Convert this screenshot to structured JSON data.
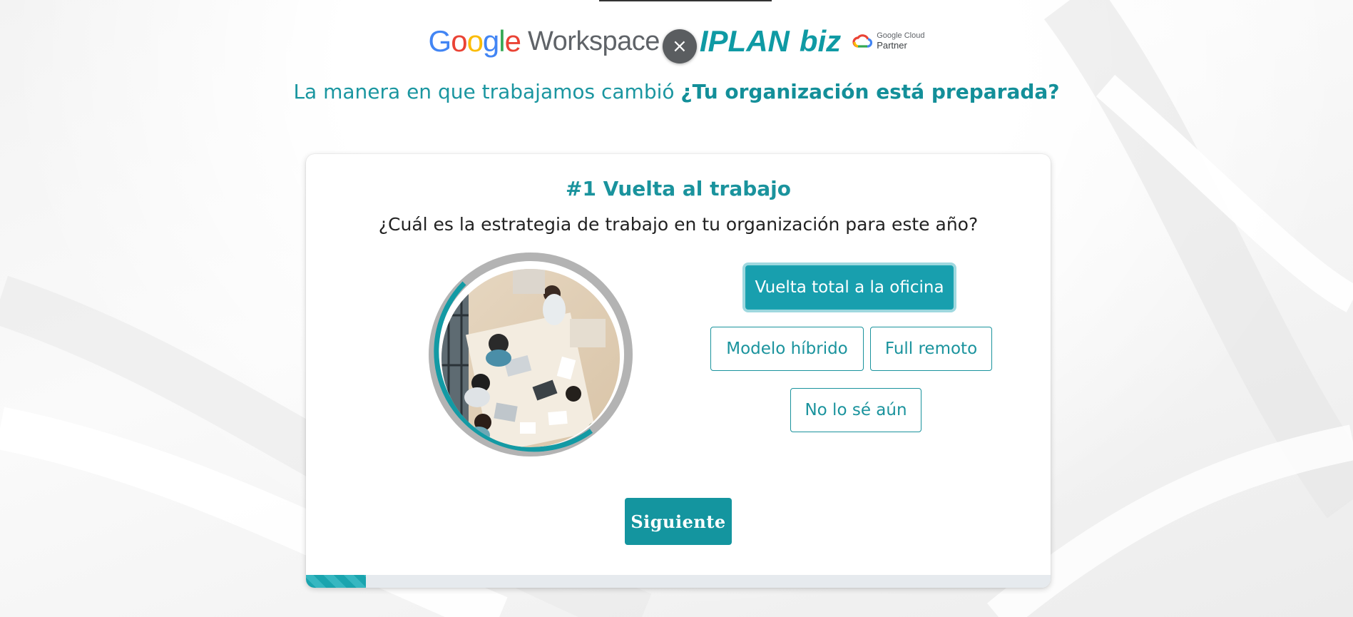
{
  "header": {
    "brand_google": "Google",
    "brand_workspace": "Workspace",
    "close_symbol": "×",
    "brand_iplan": "IPLAN",
    "brand_biz": "biz",
    "partner_line1": "Google Cloud",
    "partner_line2": "Partner"
  },
  "headline": {
    "text_regular": "La manera en que trabajamos cambió ",
    "text_bold": "¿Tu organización está preparada?"
  },
  "quiz": {
    "title": "#1 Vuelta al trabajo",
    "question": "¿Cuál es la estrategia de trabajo en tu organización para este año?",
    "options": [
      {
        "label": "Vuelta total a la oficina",
        "selected": true
      },
      {
        "label": "Modelo híbrido",
        "selected": false
      },
      {
        "label": "Full remoto",
        "selected": false
      },
      {
        "label": "No lo sé aún",
        "selected": false
      }
    ],
    "next_label": "Siguiente",
    "progress": 0.08
  },
  "colors": {
    "accent": "#1a939d",
    "selected_bg": "#189fae",
    "google_blue": "#4285F4",
    "google_red": "#EA4335",
    "google_yellow": "#FBBC05",
    "google_green": "#34A853"
  }
}
